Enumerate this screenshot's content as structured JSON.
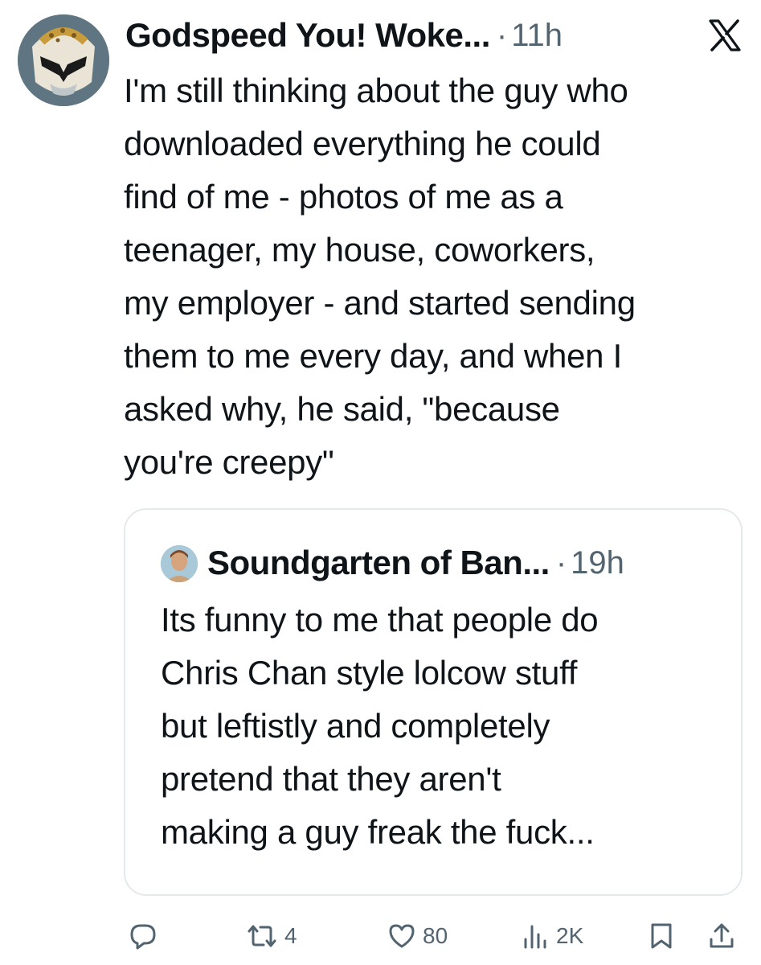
{
  "tweet": {
    "author_name": "Godspeed You! Woke...",
    "separator": "·",
    "time": "11h",
    "text": "I'm still thinking about the guy who\ndownloaded everything he could\nfind of me - photos of me as a\nteenager, my house, coworkers,\nmy employer - and started sending\nthem to me every day, and when I\nasked why, he said, \"because\nyou're creepy\"",
    "platform_icon": "x-logo-icon",
    "avatar_icon": "helmet-avatar"
  },
  "quoted_tweet": {
    "author_name": "Soundgarten of Ban...",
    "separator": "·",
    "time": "19h",
    "text": "Its funny to me that people do\nChris Chan style lolcow stuff\nbut leftistly and completely\npretend that they aren't\nmaking a guy freak the fuck..."
  },
  "actions": {
    "reply": {
      "icon": "reply-icon",
      "count": ""
    },
    "retweet": {
      "icon": "retweet-icon",
      "count": "4"
    },
    "like": {
      "icon": "heart-icon",
      "count": "80"
    },
    "views": {
      "icon": "views-icon",
      "count": "2K"
    },
    "bookmark": {
      "icon": "bookmark-icon"
    },
    "share": {
      "icon": "share-icon"
    }
  },
  "colors": {
    "text": "#0f1419",
    "secondary": "#536471",
    "border": "#e6e9ec"
  }
}
